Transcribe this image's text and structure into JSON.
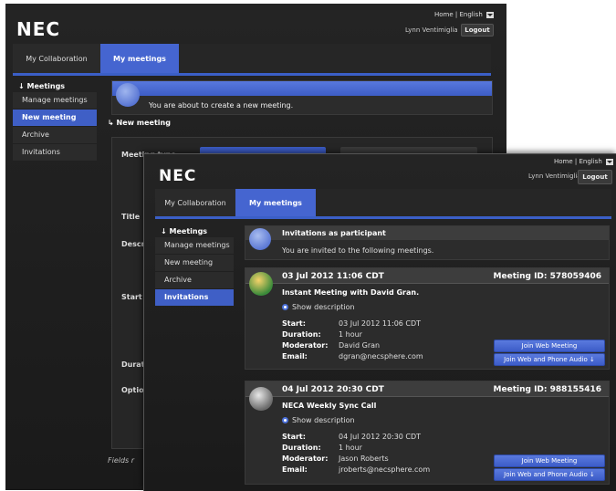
{
  "back_window": {
    "logo": "NEC",
    "home": "Home",
    "sep": "|",
    "lang": "English",
    "user": "Lynn Ventimiglia",
    "logout": "Logout",
    "tabs": [
      "My Collaboration",
      "My meetings"
    ],
    "sidebar": {
      "header": "Meetings",
      "items": [
        "Manage meetings",
        "New meeting",
        "Archive",
        "Invitations"
      ]
    },
    "notice": "You are about to create a new meeting.",
    "section": "New meeting",
    "fields": [
      "Meeting type",
      "Title",
      "Descri",
      "Start",
      "Durati",
      "Option"
    ],
    "footer": "Fields r"
  },
  "front_window": {
    "logo": "NEC",
    "home": "Home",
    "sep": "|",
    "lang": "English",
    "user": "Lynn Ventimiglia",
    "logout": "Logout",
    "tabs": [
      "My Collaboration",
      "My meetings"
    ],
    "sidebar": {
      "header": "Meetings",
      "items": [
        "Manage meetings",
        "New meeting",
        "Archive",
        "Invitations"
      ]
    },
    "invitations_title": "Invitations as participant",
    "invitations_sub": "You are invited to the following meetings.",
    "meetings": [
      {
        "date": "03 Jul 2012 11:06 CDT",
        "meeting_id": "Meeting ID: 578059406",
        "title": "Instant Meeting with David Gran.",
        "show_desc": "Show description",
        "start_label": "Start:",
        "start": "03 Jul 2012 11:06 CDT",
        "duration_label": "Duration:",
        "duration": "1 hour",
        "moderator_label": "Moderator:",
        "moderator": "David Gran",
        "email_label": "Email:",
        "email": "dgran@necsphere.com",
        "join_web": "Join Web Meeting",
        "join_phone": "Join Web and Phone Audio"
      },
      {
        "date": "04 Jul 2012 20:30 CDT",
        "meeting_id": "Meeting ID: 988155416",
        "title": "NECA Weekly Sync Call",
        "show_desc": "Show description",
        "start_label": "Start:",
        "start": "04 Jul 2012 20:30 CDT",
        "duration_label": "Duration:",
        "duration": "1 hour",
        "moderator_label": "Moderator:",
        "moderator": "Jason Roberts",
        "email_label": "Email:",
        "email": "jroberts@necsphere.com",
        "join_web": "Join Web Meeting",
        "join_phone": "Join Web and Phone Audio"
      }
    ]
  }
}
